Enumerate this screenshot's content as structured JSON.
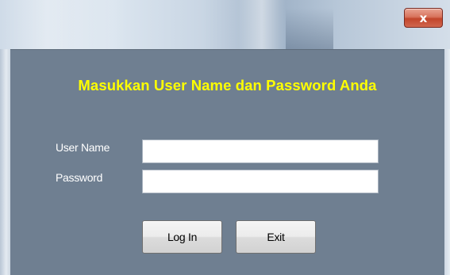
{
  "titlebar": {
    "close_glyph": "x"
  },
  "form": {
    "heading": "Masukkan User Name dan Password Anda",
    "username_label": "User Name",
    "username_value": "",
    "password_label": "Password",
    "password_value": "",
    "login_label": "Log In",
    "exit_label": "Exit"
  },
  "colors": {
    "client_background": "#6f7f91",
    "heading_text": "#ffff00",
    "label_text": "#ffffff",
    "close_button": "#c2452b"
  },
  "icons": {
    "close": "close-icon"
  }
}
